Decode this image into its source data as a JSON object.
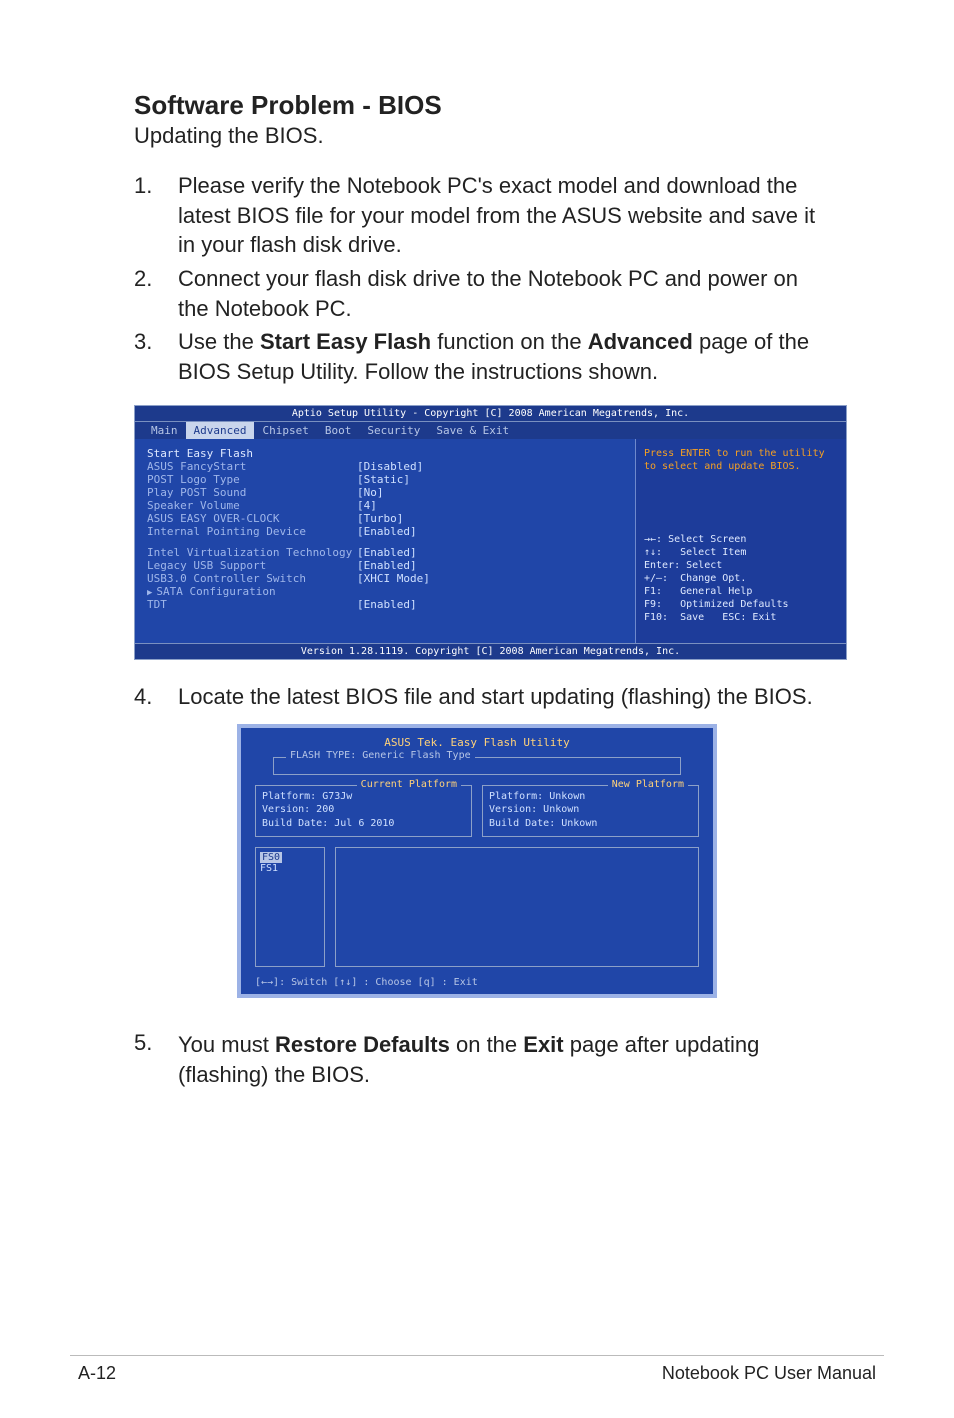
{
  "doc": {
    "title": "Software Problem - BIOS",
    "subtitle": "Updating the BIOS.",
    "steps": {
      "s1": {
        "num": "1.",
        "text": "Please verify the Notebook PC's exact model and download the latest BIOS file for your model from the ASUS website and save it in your flash disk drive."
      },
      "s2": {
        "num": "2.",
        "text": "Connect your flash disk drive to the Notebook PC and power on the Notebook PC."
      },
      "s3": {
        "num": "3.",
        "pre": "Use the ",
        "b1": "Start Easy Flash",
        "mid": " function on the ",
        "b2": "Advanced",
        "post": " page of the BIOS Setup Utility. Follow the instructions shown."
      },
      "s4": {
        "num": "4.",
        "text": "Locate the latest BIOS file and start updating (flashing) the BIOS."
      },
      "s5": {
        "num": "5.",
        "pre": "You must ",
        "b1": "Restore Defaults",
        "mid": " on the ",
        "b2": "Exit",
        "post": " page after updating (flashing) the BIOS."
      }
    }
  },
  "bios1": {
    "top": "Aptio Setup Utility - Copyright [C] 2008 American Megatrends, Inc.",
    "tabs": {
      "t0": "Main",
      "t1": "Advanced",
      "t2": "Chipset",
      "t3": "Boot",
      "t4": "Security",
      "t5": "Save & Exit"
    },
    "rows": {
      "r0": {
        "k": "Start Easy Flash",
        "v": ""
      },
      "r1": {
        "k": "ASUS FancyStart",
        "v": "[Disabled]"
      },
      "r2": {
        "k": "POST Logo Type",
        "v": "[Static]"
      },
      "r3": {
        "k": "Play POST Sound",
        "v": "[No]"
      },
      "r4": {
        "k": "Speaker Volume",
        "v": "[4]"
      },
      "r5": {
        "k": "ASUS EASY OVER-CLOCK",
        "v": "[Turbo]"
      },
      "r6": {
        "k": "Internal Pointing Device",
        "v": "[Enabled]"
      },
      "r7": {
        "k": "Intel Virtualization Technology",
        "v": "[Enabled]"
      },
      "r8": {
        "k": "Legacy USB Support",
        "v": "[Enabled]"
      },
      "r9": {
        "k": "USB3.0 Controller Switch",
        "v": "[XHCI Mode]"
      },
      "r10": {
        "k": "SATA Configuration",
        "v": ""
      },
      "r11": {
        "k": "TDT",
        "v": "[Enabled]"
      }
    },
    "help": {
      "h1": "Press ENTER to run the utility",
      "h2": "to select and update BIOS.",
      "n0": "→←: Select Screen",
      "n1": "↑↓:   Select Item",
      "n2": "Enter: Select",
      "n3": "+/—:  Change Opt.",
      "n4": "F1:   General Help",
      "n5": "F9:   Optimized Defaults",
      "n6": "F10:  Save   ESC: Exit"
    },
    "bottom": "Version 1.28.1119. Copyright [C] 2008 American Megatrends, Inc."
  },
  "bios2": {
    "title": "ASUS Tek. Easy Flash Utility",
    "flashtype": "FLASH TYPE: Generic Flash Type",
    "cur": {
      "label": "Current Platform",
      "l1": "Platform:  G73Jw",
      "l2": "Version:   200",
      "l3": "Build Date: Jul 6 2010"
    },
    "new": {
      "label": "New Platform",
      "l1": "Platform:  Unkown",
      "l2": "Version:   Unkown",
      "l3": "Build Date: Unkown"
    },
    "fs": {
      "a": "FS0",
      "b": "FS1"
    },
    "nav": "[←→]: Switch   [↑↓] : Choose   [q] : Exit"
  },
  "footer": {
    "left": "A-12",
    "right": "Notebook PC User Manual"
  }
}
